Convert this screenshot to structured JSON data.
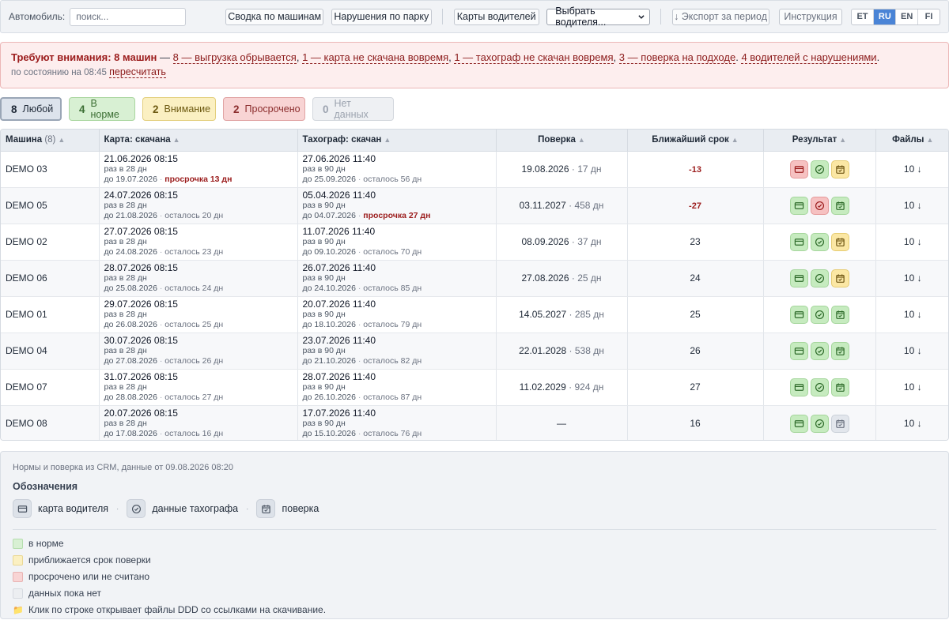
{
  "toolbar": {
    "vehicle_label": "Автомобиль:",
    "search_placeholder": "поиск...",
    "summary_btn": "Сводка по машинам",
    "violations_btn": "Нарушения по парку",
    "driver_cards_btn": "Карты водителей",
    "driver_select": "Выбрать водителя...",
    "export_btn": "↓ Экспорт за период",
    "manual_btn": "Инструкция",
    "languages": [
      "ET",
      "RU",
      "EN",
      "FI"
    ],
    "active_language": "RU"
  },
  "alert": {
    "title": "Требуют внимания: 8 машин",
    "dash": "—",
    "items": [
      "8 — выгрузка обрывается",
      "1 — карта не скачана вовремя",
      "1 — тахограф не скачан вовремя",
      "3 — поверка на подходе"
    ],
    "drivers": "4 водителей с нарушениями",
    "status_prefix": "по состоянию на 08:45",
    "recalc": "пересчитать"
  },
  "filters": [
    {
      "count": "8",
      "label": "Любой",
      "kind": "any"
    },
    {
      "count": "4",
      "label": "В норме",
      "kind": "ok"
    },
    {
      "count": "2",
      "label": "Внимание",
      "kind": "warn"
    },
    {
      "count": "2",
      "label": "Просрочено",
      "kind": "bad"
    },
    {
      "count": "0",
      "label": "Нет данных",
      "kind": "none"
    }
  ],
  "table": {
    "headers": {
      "vehicle": "Машина",
      "vehicle_count": "(8)",
      "card": "Карта: скачана",
      "tacho": "Тахограф: скачан",
      "verification": "Поверка",
      "deadline": "Ближайший срок",
      "result": "Результат",
      "files": "Файлы"
    },
    "rows": [
      {
        "vehicle": "DEMO 03",
        "card": {
          "date": "21.06.2026 08:15",
          "period": "раз в 28 дн",
          "until": "до 19.07.2026",
          "status": "просрочка 13 дн",
          "overdue": true
        },
        "tacho": {
          "date": "27.06.2026 11:40",
          "period": "раз в 90 дн",
          "until": "до 25.09.2026",
          "status": "осталось 56 дн",
          "overdue": false
        },
        "verif_date": "19.08.2026",
        "verif_days": "17 дн",
        "deadline": "-13",
        "deadline_neg": true,
        "result": [
          "red",
          "green",
          "yellow"
        ],
        "files": "10 ↓"
      },
      {
        "vehicle": "DEMO 05",
        "card": {
          "date": "24.07.2026 08:15",
          "period": "раз в 28 дн",
          "until": "до 21.08.2026",
          "status": "осталось 20 дн",
          "overdue": false
        },
        "tacho": {
          "date": "05.04.2026 11:40",
          "period": "раз в 90 дн",
          "until": "до 04.07.2026",
          "status": "просрочка 27 дн",
          "overdue": true
        },
        "verif_date": "03.11.2027",
        "verif_days": "458 дн",
        "deadline": "-27",
        "deadline_neg": true,
        "result": [
          "green",
          "red",
          "green"
        ],
        "files": "10 ↓"
      },
      {
        "vehicle": "DEMO 02",
        "card": {
          "date": "27.07.2026 08:15",
          "period": "раз в 28 дн",
          "until": "до 24.08.2026",
          "status": "осталось 23 дн",
          "overdue": false
        },
        "tacho": {
          "date": "11.07.2026 11:40",
          "period": "раз в 90 дн",
          "until": "до 09.10.2026",
          "status": "осталось 70 дн",
          "overdue": false
        },
        "verif_date": "08.09.2026",
        "verif_days": "37 дн",
        "deadline": "23",
        "deadline_neg": false,
        "result": [
          "green",
          "green",
          "yellow"
        ],
        "files": "10 ↓"
      },
      {
        "vehicle": "DEMO 06",
        "card": {
          "date": "28.07.2026 08:15",
          "period": "раз в 28 дн",
          "until": "до 25.08.2026",
          "status": "осталось 24 дн",
          "overdue": false
        },
        "tacho": {
          "date": "26.07.2026 11:40",
          "period": "раз в 90 дн",
          "until": "до 24.10.2026",
          "status": "осталось 85 дн",
          "overdue": false
        },
        "verif_date": "27.08.2026",
        "verif_days": "25 дн",
        "deadline": "24",
        "deadline_neg": false,
        "result": [
          "green",
          "green",
          "yellow"
        ],
        "files": "10 ↓"
      },
      {
        "vehicle": "DEMO 01",
        "card": {
          "date": "29.07.2026 08:15",
          "period": "раз в 28 дн",
          "until": "до 26.08.2026",
          "status": "осталось 25 дн",
          "overdue": false
        },
        "tacho": {
          "date": "20.07.2026 11:40",
          "period": "раз в 90 дн",
          "until": "до 18.10.2026",
          "status": "осталось 79 дн",
          "overdue": false
        },
        "verif_date": "14.05.2027",
        "verif_days": "285 дн",
        "deadline": "25",
        "deadline_neg": false,
        "result": [
          "green",
          "green",
          "green"
        ],
        "files": "10 ↓"
      },
      {
        "vehicle": "DEMO 04",
        "card": {
          "date": "30.07.2026 08:15",
          "period": "раз в 28 дн",
          "until": "до 27.08.2026",
          "status": "осталось 26 дн",
          "overdue": false
        },
        "tacho": {
          "date": "23.07.2026 11:40",
          "period": "раз в 90 дн",
          "until": "до 21.10.2026",
          "status": "осталось 82 дн",
          "overdue": false
        },
        "verif_date": "22.01.2028",
        "verif_days": "538 дн",
        "deadline": "26",
        "deadline_neg": false,
        "result": [
          "green",
          "green",
          "green"
        ],
        "files": "10 ↓"
      },
      {
        "vehicle": "DEMO 07",
        "card": {
          "date": "31.07.2026 08:15",
          "period": "раз в 28 дн",
          "until": "до 28.08.2026",
          "status": "осталось 27 дн",
          "overdue": false
        },
        "tacho": {
          "date": "28.07.2026 11:40",
          "period": "раз в 90 дн",
          "until": "до 26.10.2026",
          "status": "осталось 87 дн",
          "overdue": false
        },
        "verif_date": "11.02.2029",
        "verif_days": "924 дн",
        "deadline": "27",
        "deadline_neg": false,
        "result": [
          "green",
          "green",
          "green"
        ],
        "files": "10 ↓"
      },
      {
        "vehicle": "DEMO 08",
        "card": {
          "date": "20.07.2026 08:15",
          "period": "раз в 28 дн",
          "until": "до 17.08.2026",
          "status": "осталось 16 дн",
          "overdue": false
        },
        "tacho": {
          "date": "17.07.2026 11:40",
          "period": "раз в 90 дн",
          "until": "до 15.10.2026",
          "status": "осталось 76 дн",
          "overdue": false
        },
        "verif_date": "—",
        "verif_days": "",
        "deadline": "16",
        "deadline_neg": false,
        "result": [
          "green",
          "green",
          "gray"
        ],
        "files": "10 ↓"
      }
    ]
  },
  "legend": {
    "note": "Нормы и поверка из CRM, данные от 09.08.2026 08:20",
    "title": "Обозначения",
    "icons": [
      {
        "icon": "card-icon",
        "label": "карта водителя"
      },
      {
        "icon": "gauge-icon",
        "label": "данные тахографа"
      },
      {
        "icon": "calendar-check-icon",
        "label": "поверка"
      }
    ],
    "separator": "·",
    "statuses": [
      {
        "color": "green",
        "label": "в норме"
      },
      {
        "color": "yellow",
        "label": "приближается срок поверки"
      },
      {
        "color": "red",
        "label": "просрочено или не считано"
      },
      {
        "color": "gray",
        "label": "данных пока нет"
      }
    ],
    "hint": "Клик по строке открывает файлы DDD со ссылками на скачивание.",
    "hint_icon": "folder-icon"
  },
  "colors": {
    "accent": "#4a84d6",
    "ok": "#c6ebbf",
    "warn": "#fbe7a4",
    "bad": "#f6c1c1",
    "none": "#e2e6ec",
    "alert_bg": "#fdeeee"
  }
}
